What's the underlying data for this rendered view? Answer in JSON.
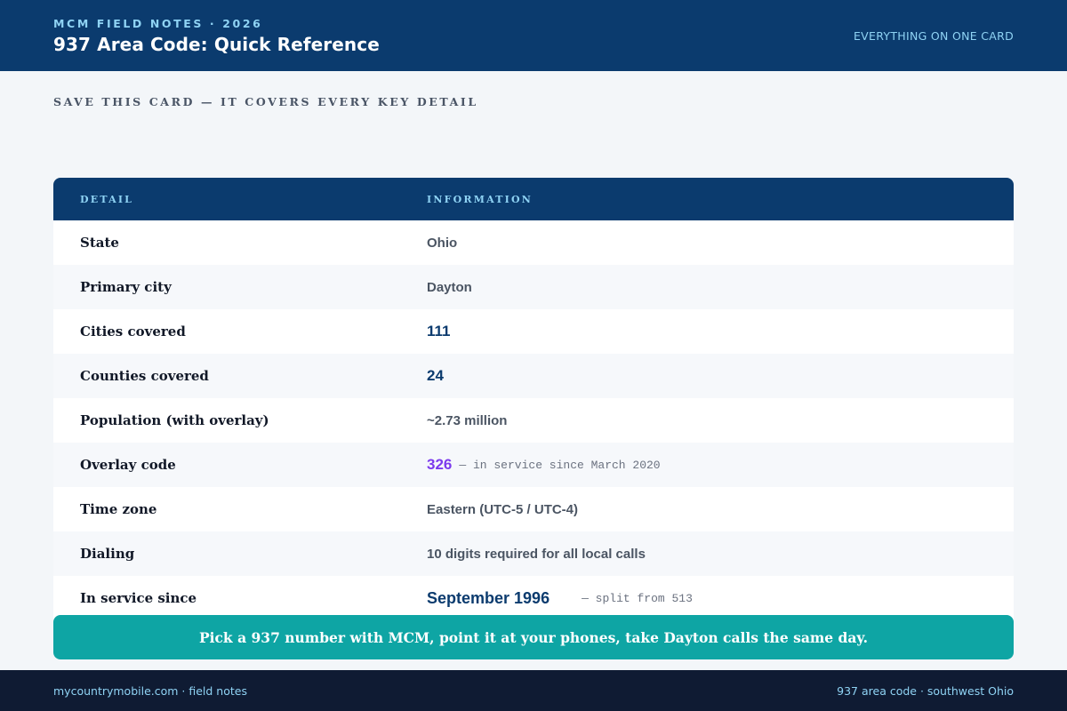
{
  "header": {
    "kicker": "MCM FIELD NOTES · 2026",
    "title": "937 Area Code: Quick Reference",
    "right_label": "EVERYTHING ON ONE CARD"
  },
  "subheading": "SAVE THIS CARD — IT COVERS EVERY KEY DETAIL",
  "table": {
    "columns": [
      "DETAIL",
      "INFORMATION"
    ],
    "rows": [
      {
        "label": "State",
        "value": "Ohio"
      },
      {
        "label": "Primary city",
        "value": "Dayton"
      },
      {
        "label": "Cities covered",
        "value": "111"
      },
      {
        "label": "Counties covered",
        "value": "24"
      },
      {
        "label": "Population (with overlay)",
        "value": "~2.73 million"
      },
      {
        "label": "Overlay code",
        "value": "326",
        "note": "— in service since March 2020"
      },
      {
        "label": "Time zone",
        "value": "Eastern (UTC-5 / UTC-4)"
      },
      {
        "label": "Dialing",
        "value": "10 digits required for all local calls"
      },
      {
        "label": "In service since",
        "value": "September 1996",
        "note": "— split from 513"
      }
    ]
  },
  "cta": "Pick a 937 number with MCM, point it at your phones, take Dayton calls the same day.",
  "footer": {
    "left": "mycountrymobile.com · field notes",
    "right": "937 area code · southwest Ohio"
  },
  "colors": {
    "header_bg": "#0b3b6e",
    "accent_light": "#8fd3f4",
    "cta_bg": "#0ea5a4",
    "overlay_accent": "#7c3aed",
    "footer_bg": "#0f1b33"
  }
}
